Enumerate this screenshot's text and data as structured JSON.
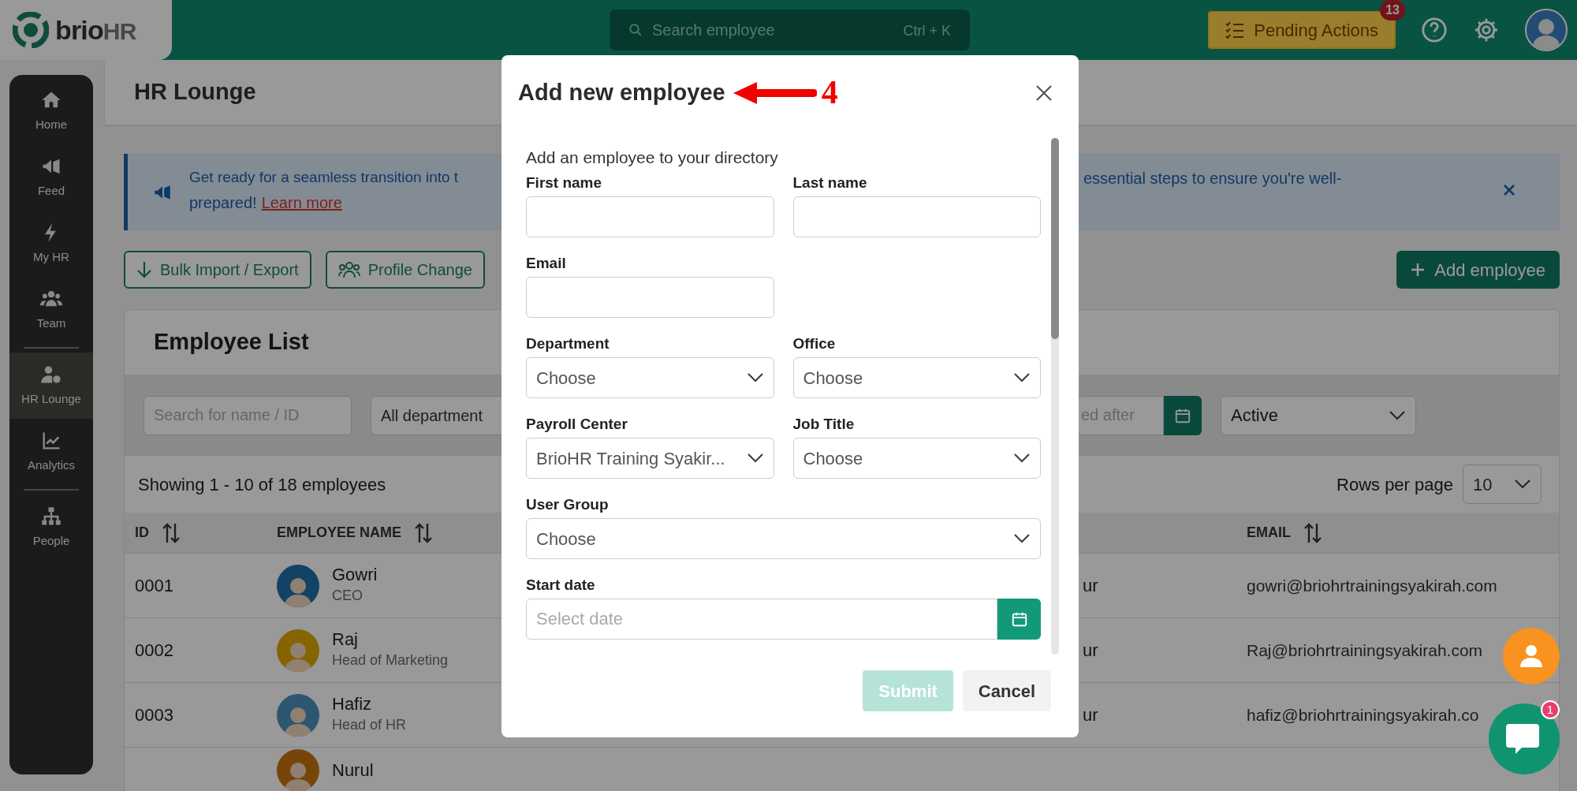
{
  "topbar": {
    "logo": {
      "brand": "brio",
      "suffix": "HR"
    },
    "search": {
      "placeholder": "Search employee",
      "shortcut": "Ctrl + K"
    },
    "pending": {
      "label": "Pending Actions",
      "count": "13"
    }
  },
  "sidebar": {
    "groups": [
      [
        {
          "label": "Home",
          "selected": false
        },
        {
          "label": "Feed",
          "selected": false
        },
        {
          "label": "My HR",
          "selected": false
        },
        {
          "label": "Team",
          "selected": false
        }
      ],
      [
        {
          "label": "HR Lounge",
          "selected": true
        },
        {
          "label": "Analytics",
          "selected": false
        }
      ],
      [
        {
          "label": "People",
          "selected": false
        }
      ]
    ]
  },
  "page": {
    "title": "HR Lounge"
  },
  "banner": {
    "text_left": "Get ready for a seamless transition into t",
    "text_right": "essential steps to ensure you're well-",
    "text_line2": "prepared!",
    "link": "Learn more"
  },
  "actions": [
    {
      "label": "Bulk Import / Export"
    },
    {
      "label": "Profile Change"
    }
  ],
  "add_button": "Add employee",
  "employee_list": {
    "title": "Employee List",
    "filters": {
      "search_placeholder": "Search for name / ID",
      "department": "All department",
      "date_placeholder": "ed after",
      "status": "Active"
    },
    "summary": "Showing 1 - 10 of 18 employees",
    "rows_per_page": {
      "label": "Rows per page",
      "value": "10"
    },
    "columns": [
      "ID",
      "EMPLOYEE NAME",
      "EMAIL"
    ],
    "rows": [
      {
        "id": "0001",
        "name": "Gowri",
        "title": "CEO",
        "office": "ur",
        "email": "gowri@briohrtrainingsyakirah.com"
      },
      {
        "id": "0002",
        "name": "Raj",
        "title": "Head of Marketing",
        "office": "ur",
        "email": "Raj@briohrtrainingsyakirah.com"
      },
      {
        "id": "0003",
        "name": "Hafiz",
        "title": "Head of HR",
        "office": "ur",
        "email": "hafiz@briohrtrainingsyakirah.co"
      },
      {
        "name": "Nurul"
      }
    ]
  },
  "modal": {
    "title": "Add new employee",
    "annotation": {
      "label": "4"
    },
    "subtitle": "Add an employee to your directory",
    "rows": [
      [
        {
          "kind": "text",
          "label": "First name"
        },
        {
          "kind": "text",
          "label": "Last name"
        }
      ],
      [
        {
          "kind": "text",
          "label": "Email"
        }
      ],
      [
        {
          "kind": "select",
          "label": "Department",
          "value": "Choose"
        },
        {
          "kind": "select",
          "label": "Office",
          "value": "Choose"
        }
      ],
      [
        {
          "kind": "select",
          "label": "Payroll Center",
          "value": "BrioHR Training Syakir..."
        },
        {
          "kind": "select",
          "label": "Job Title",
          "value": "Choose"
        }
      ],
      [
        {
          "kind": "select",
          "label": "User Group",
          "value": "Choose"
        }
      ],
      [
        {
          "kind": "date",
          "label": "Start date",
          "placeholder": "Select date"
        }
      ]
    ],
    "buttons": [
      {
        "label": "Submit",
        "kind": "primary",
        "disabled": true
      },
      {
        "label": "Cancel",
        "kind": "secondary",
        "disabled": false
      }
    ]
  },
  "chat": {
    "badge": "1"
  }
}
